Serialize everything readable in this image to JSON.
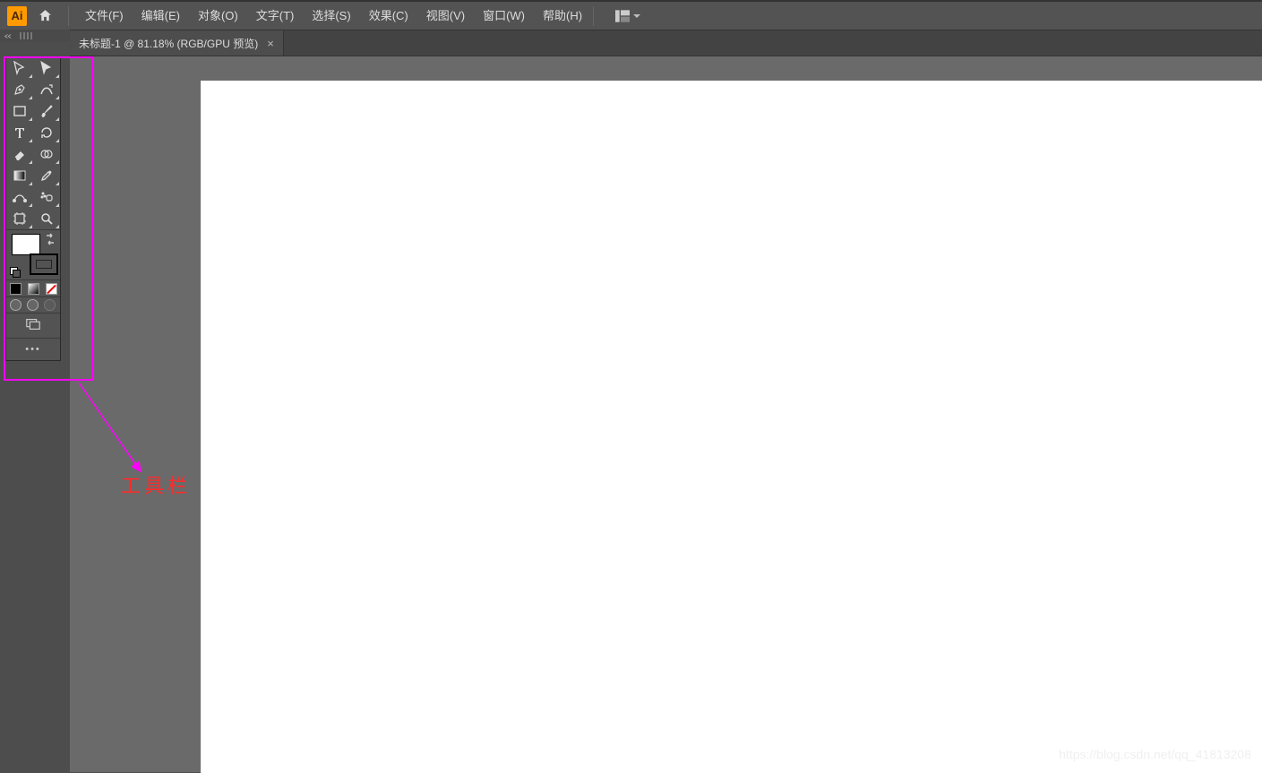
{
  "app": {
    "logo_text": "Ai"
  },
  "menu": {
    "items": [
      "文件(F)",
      "编辑(E)",
      "对象(O)",
      "文字(T)",
      "选择(S)",
      "效果(C)",
      "视图(V)",
      "窗口(W)",
      "帮助(H)"
    ]
  },
  "tab": {
    "title": "未标题-1 @ 81.18% (RGB/GPU 预览)",
    "close": "×"
  },
  "tools": {
    "names": [
      "selection-tool",
      "direct-selection-tool",
      "pen-tool",
      "curvature-tool",
      "rectangle-tool",
      "paintbrush-tool",
      "type-tool",
      "rotate-tool",
      "eraser-tool",
      "shape-builder-tool",
      "gradient-tool",
      "eyedropper-tool",
      "blend-tool",
      "symbol-sprayer-tool",
      "artboard-tool",
      "zoom-tool"
    ]
  },
  "colors": {
    "fill": "#ffffff",
    "stroke": "#000000"
  },
  "annotation": {
    "label": "工具栏"
  },
  "watermark": "https://blog.csdn.net/qq_41813208"
}
